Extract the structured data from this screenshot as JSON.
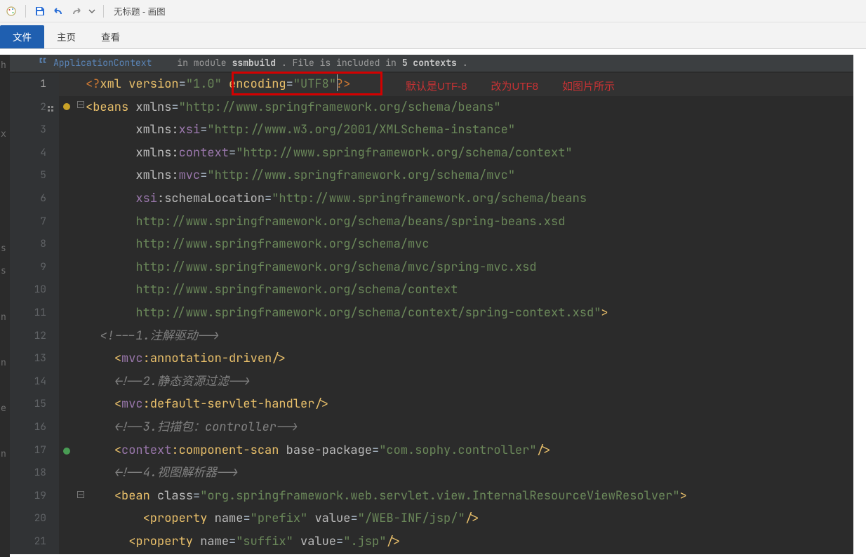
{
  "window": {
    "title": "无标题 - 画图"
  },
  "ribbon": {
    "tabs": [
      "文件",
      "主页",
      "查看"
    ],
    "active": 0
  },
  "breadcrumb": {
    "context": "ApplicationContext",
    "module_pre": "in module ",
    "module": "ssmbuild",
    "mid": ". File is included in ",
    "contexts": "5 contexts",
    "tail": "."
  },
  "annotations": {
    "a1": "默认是UTF-8",
    "a2": "改为UTF8",
    "a3": "如图片所示"
  },
  "selected_line": 1,
  "left_strip": [
    "h",
    "",
    "",
    "x",
    "",
    "",
    "",
    "",
    "s",
    "s",
    "",
    "n",
    "",
    "n",
    "",
    "e",
    "",
    "n",
    "",
    "",
    ""
  ],
  "code": {
    "lines": [
      {
        "n": 1,
        "html": "<span class='t-kw'>&lt;?</span><span class='t-tag'>xml version</span><span class='t-punc'>=</span><span class='t-str'>\"1.0\"</span> <span class='t-tag'>encoding</span><span class='t-punc'>=</span><span class='t-str'>\"UTF8\"</span><span class='t-kw'>?&gt;</span>"
      },
      {
        "n": 2,
        "html": "<span class='t-tag'>&lt;beans</span> <span class='t-attr'>xmlns</span><span class='t-punc'>=</span><span class='t-str'>\"http://www.springframework.org/schema/beans\"</span>"
      },
      {
        "n": 3,
        "html": "       <span class='t-attr'>xmlns:</span><span class='t-ns'>xsi</span><span class='t-punc'>=</span><span class='t-str'>\"http://www.w3.org/2001/XMLSchema-instance\"</span>"
      },
      {
        "n": 4,
        "html": "       <span class='t-attr'>xmlns:</span><span class='t-ns'>context</span><span class='t-punc'>=</span><span class='t-str'>\"http://www.springframework.org/schema/context\"</span>"
      },
      {
        "n": 5,
        "html": "       <span class='t-attr'>xmlns:</span><span class='t-ns'>mvc</span><span class='t-punc'>=</span><span class='t-str'>\"http://www.springframework.org/schema/mvc\"</span>"
      },
      {
        "n": 6,
        "html": "       <span class='t-ns'>xsi</span><span class='t-attr'>:schemaLocation</span><span class='t-punc'>=</span><span class='t-str'>\"http://www.springframework.org/schema/beans</span>"
      },
      {
        "n": 7,
        "html": "       <span class='t-str'>http://www.springframework.org/schema/beans/spring-beans.xsd</span>"
      },
      {
        "n": 8,
        "html": "       <span class='t-str'>http://www.springframework.org/schema/mvc</span>"
      },
      {
        "n": 9,
        "html": "       <span class='t-str'>http://www.springframework.org/schema/mvc/spring-mvc.xsd</span>"
      },
      {
        "n": 10,
        "html": "       <span class='t-str'>http://www.springframework.org/schema/context</span>"
      },
      {
        "n": 11,
        "html": "       <span class='t-str'>http://www.springframework.org/schema/context/spring-context.xsd\"</span><span class='t-tag'>&gt;</span>"
      },
      {
        "n": 12,
        "html": "  <span class='t-cmt'>&lt;!---1.注解驱动--&gt;</span>"
      },
      {
        "n": 13,
        "html": "    <span class='t-tag'>&lt;</span><span class='t-ns'>mvc</span><span class='t-tag'>:annotation-driven/&gt;</span>"
      },
      {
        "n": 14,
        "html": "    <span class='t-cmt'>&lt;!--2.静态资源过滤--&gt;</span>"
      },
      {
        "n": 15,
        "html": "    <span class='t-tag'>&lt;</span><span class='t-ns'>mvc</span><span class='t-tag'>:default-servlet-handler/&gt;</span>"
      },
      {
        "n": 16,
        "html": "    <span class='t-cmt'>&lt;!--3.扫描包：controller--&gt;</span>"
      },
      {
        "n": 17,
        "html": "    <span class='t-tag'>&lt;</span><span class='t-ns'>context</span><span class='t-tag'>:component-scan</span> <span class='t-attr'>base-package</span><span class='t-punc'>=</span><span class='t-str'>\"com.sophy.controller\"</span><span class='t-tag'>/&gt;</span>"
      },
      {
        "n": 18,
        "html": "    <span class='t-cmt'>&lt;!--4.视图解析器--&gt;</span>"
      },
      {
        "n": 19,
        "html": "    <span class='t-tag'>&lt;bean</span> <span class='t-attr'>class</span><span class='t-punc'>=</span><span class='t-str'>\"org.springframework.web.servlet.view.InternalResourceViewResolver\"</span><span class='t-tag'>&gt;</span>"
      },
      {
        "n": 20,
        "html": "        <span class='t-tag'>&lt;property</span> <span class='t-attr'>name</span><span class='t-punc'>=</span><span class='t-str'>\"prefix\"</span> <span class='t-attr'>value</span><span class='t-punc'>=</span><span class='t-str'>\"/WEB-INF/jsp/\"</span><span class='t-tag'>/&gt;</span>"
      },
      {
        "n": 21,
        "html": "      <span class='t-tag'>&lt;property</span> <span class='t-attr'>name</span><span class='t-punc'>=</span><span class='t-str'>\"suffix\"</span> <span class='t-attr'>value</span><span class='t-punc'>=</span><span class='t-str'>\".jsp\"</span><span class='t-tag'>/&gt;</span>"
      }
    ]
  }
}
